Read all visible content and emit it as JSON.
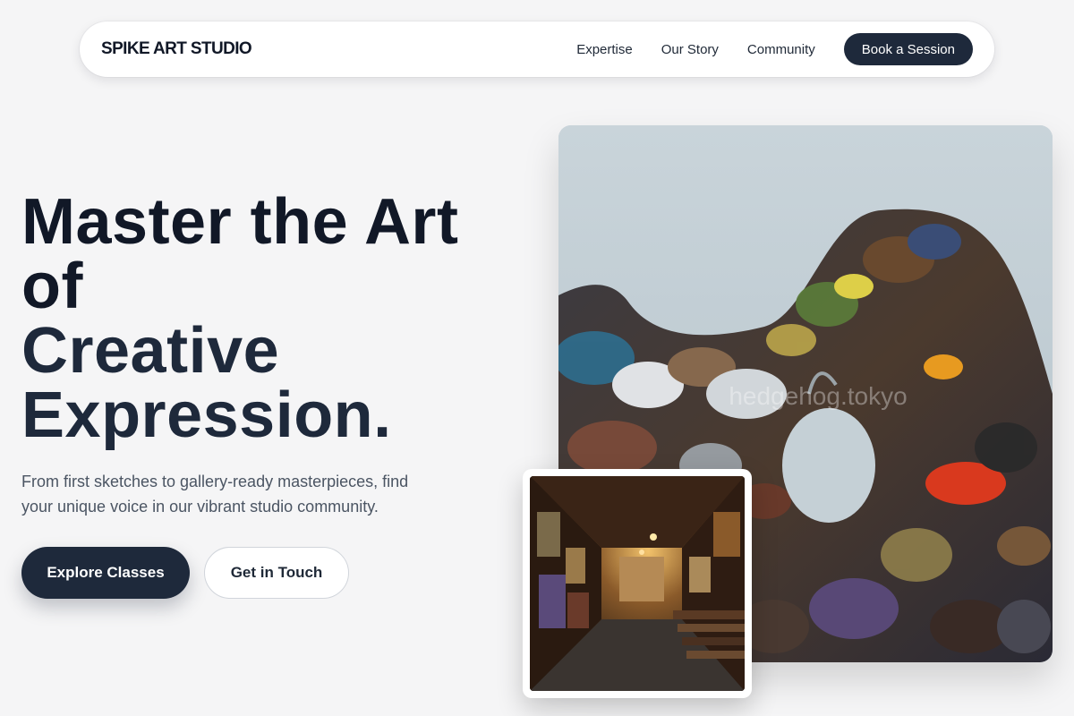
{
  "nav": {
    "brand": "SPIKE ART STUDIO",
    "links": [
      "Expertise",
      "Our Story",
      "Community"
    ],
    "cta": "Book a Session"
  },
  "hero": {
    "headline_lines": [
      "Master the Art",
      "of",
      "Creative",
      "Expression."
    ],
    "subtitle": "From first sketches to gallery-ready masterpieces, find your unique voice in our vibrant studio community.",
    "primary_button": "Explore Classes",
    "secondary_button": "Get in Touch"
  },
  "images": {
    "main": {
      "subject": "paint palette",
      "watermark": "hedgehog.tokyo"
    },
    "small": {
      "subject": "art gallery corridor"
    }
  },
  "colors": {
    "background": "#f5f5f6",
    "primary_dark": "#1e293b",
    "text_dark": "#111827",
    "text_muted": "#4b5563"
  }
}
